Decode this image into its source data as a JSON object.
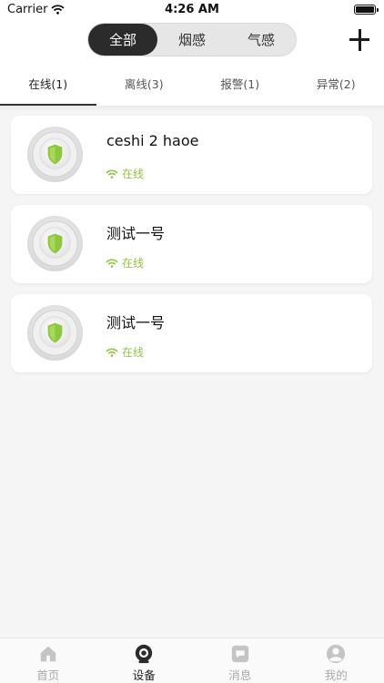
{
  "status_bar": {
    "carrier": "Carrier",
    "time": "4:26 AM"
  },
  "segment": {
    "items": [
      "全部",
      "烟感",
      "气感"
    ],
    "selected": 0
  },
  "tabs": [
    {
      "label": "在线(1)",
      "active": true
    },
    {
      "label": "离线(3)",
      "active": false
    },
    {
      "label": "报警(1)",
      "active": false
    },
    {
      "label": "异常(2)",
      "active": false
    }
  ],
  "devices": [
    {
      "name": "ceshi 2 haoe",
      "status": "在线"
    },
    {
      "name": "测试一号",
      "status": "在线"
    },
    {
      "name": "测试一号",
      "status": "在线"
    }
  ],
  "tab_bar": [
    {
      "label": "首页",
      "icon": "home-icon",
      "active": false
    },
    {
      "label": "设备",
      "icon": "device-icon",
      "active": true
    },
    {
      "label": "消息",
      "icon": "message-icon",
      "active": false
    },
    {
      "label": "我的",
      "icon": "profile-icon",
      "active": false
    }
  ],
  "colors": {
    "online": "#8ec63f",
    "accent_dark": "#2b2b2b",
    "shield": "#8dc63f"
  }
}
